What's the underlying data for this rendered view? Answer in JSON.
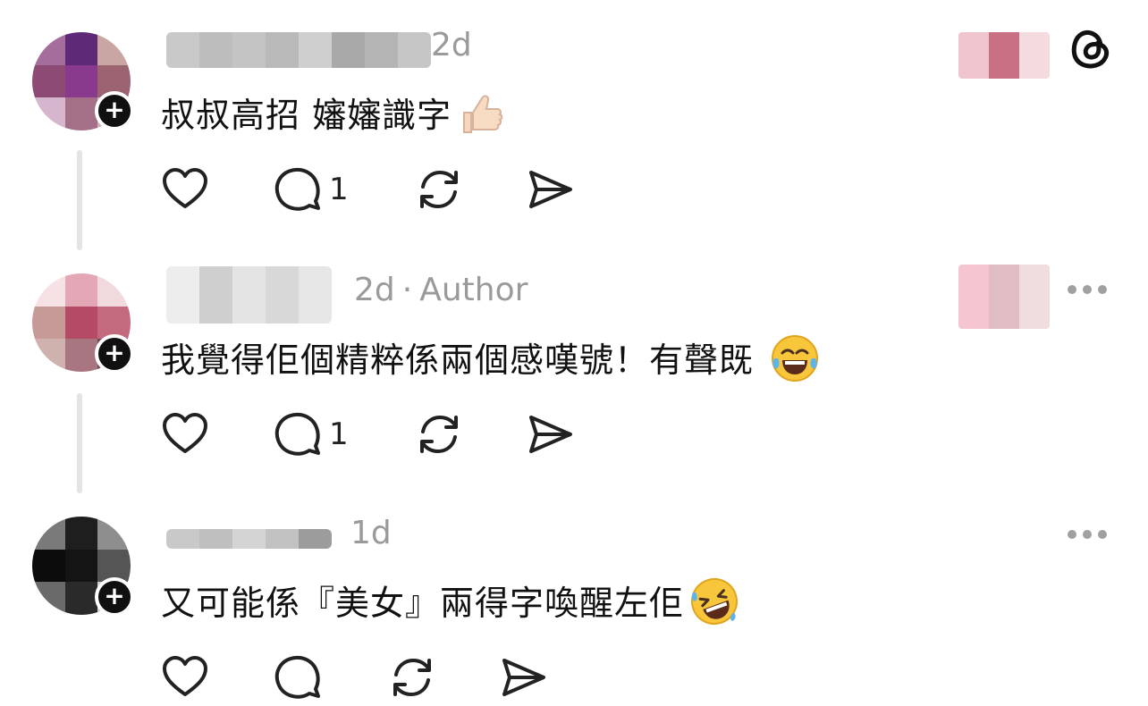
{
  "posts": [
    {
      "time": "2d",
      "author_tag": "",
      "text": "叔叔高招 嬸嬸識字",
      "reply_count": "1",
      "icons": [
        "heart-icon",
        "comment-icon",
        "repost-icon",
        "share-icon"
      ]
    },
    {
      "time": "2d",
      "author_tag": "Author",
      "text": "我覺得佢個精粹係兩個感嘆號！有聲既",
      "reply_count": "1",
      "icons": [
        "heart-icon",
        "comment-icon",
        "repost-icon",
        "share-icon"
      ]
    },
    {
      "time": "1d",
      "author_tag": "",
      "text": "又可能係『美女』兩得字喚醒左佢",
      "reply_count": "",
      "icons": [
        "heart-icon",
        "comment-icon",
        "repost-icon",
        "share-icon"
      ]
    }
  ],
  "header": {
    "app_icon": "threads-logo-icon",
    "more_icon": "more-options-icon"
  },
  "colors": {
    "text": "#111111",
    "meta": "#9a9a9a",
    "thread_line": "#e4e4e4",
    "icon_stroke": "#222222"
  }
}
